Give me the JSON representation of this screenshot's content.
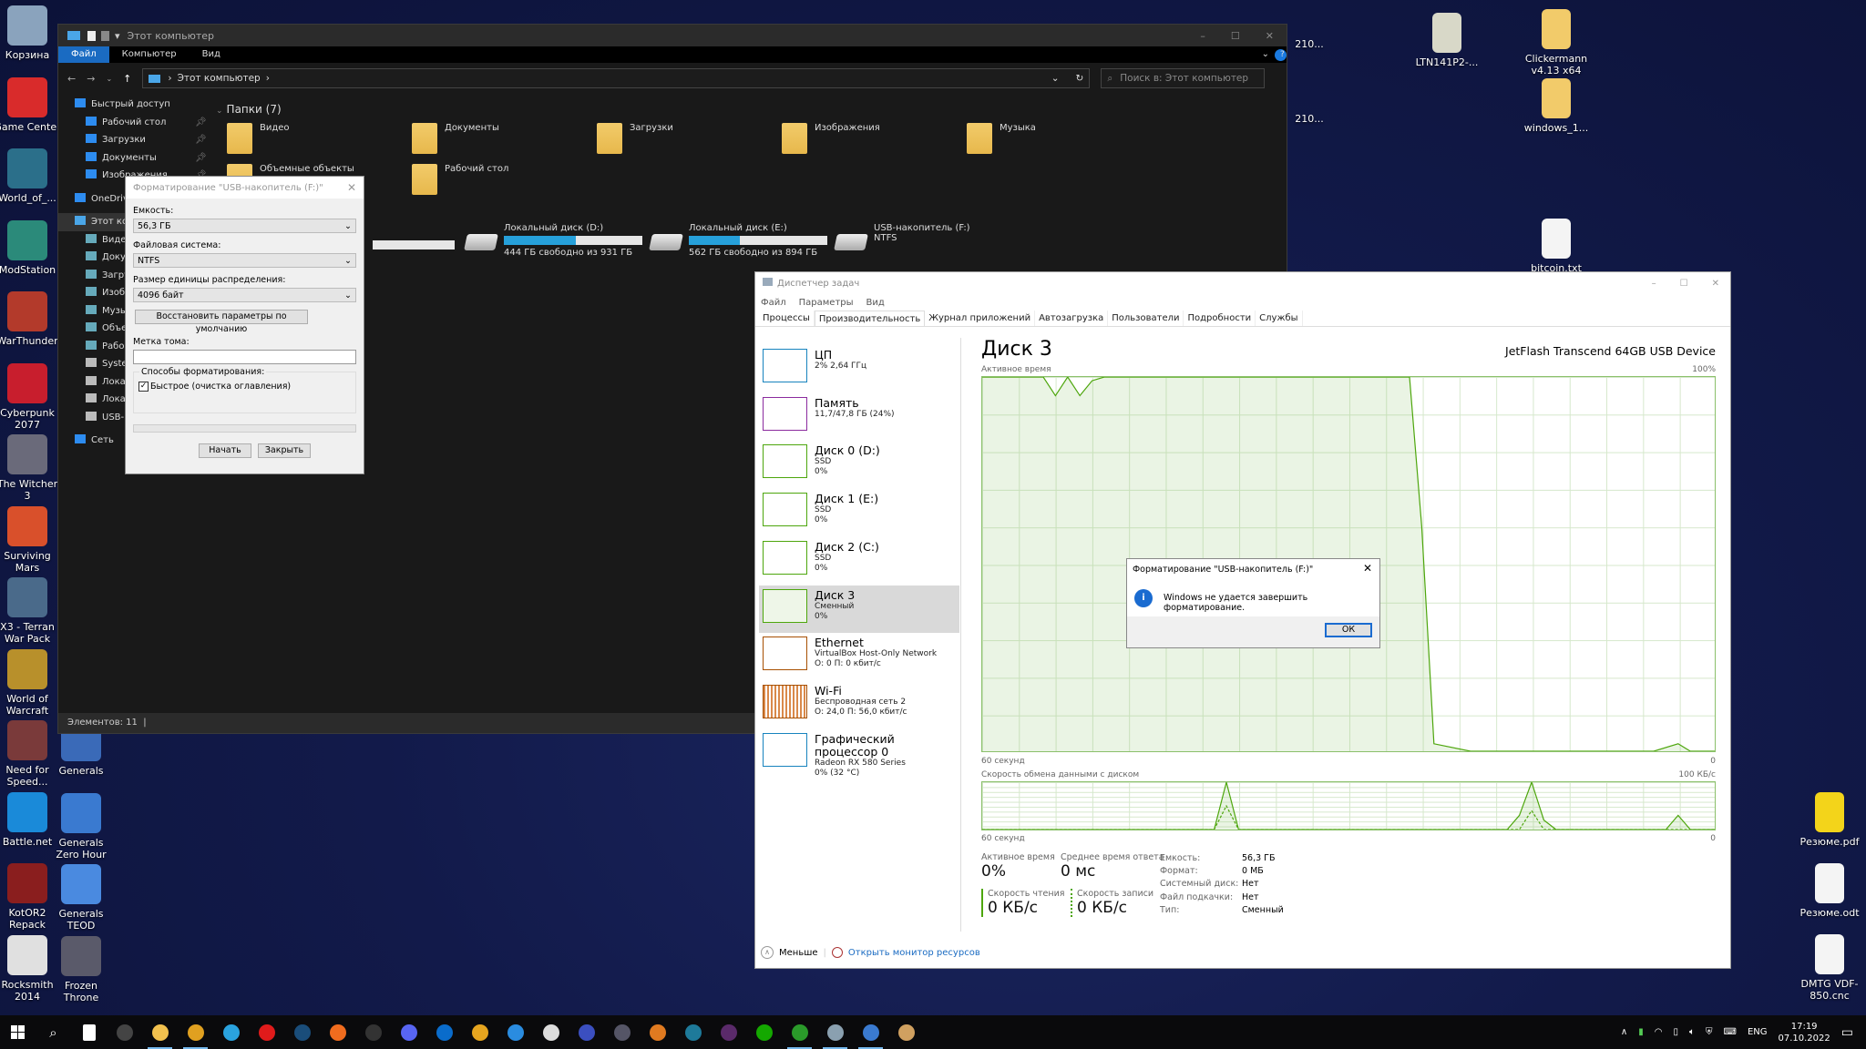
{
  "desktop": {
    "left_icons": [
      {
        "label": "Корзина",
        "color": "#8aa3bd"
      },
      {
        "label": "Game Center",
        "color": "#d92b2b"
      },
      {
        "label": "World_of_...",
        "color": "#2b6f8a"
      },
      {
        "label": "ModStation",
        "color": "#2b8a7a"
      },
      {
        "label": "WarThunder",
        "color": "#b33a2b"
      },
      {
        "label": "Cyberpunk 2077",
        "color": "#c81e2d"
      },
      {
        "label": "The Witcher 3",
        "color": "#6a6a7a"
      },
      {
        "label": "Surviving Mars",
        "color": "#d9502b"
      },
      {
        "label": "X3 - Terran War Pack",
        "color": "#4a6a8a"
      },
      {
        "label": "World of Warcraft",
        "color": "#b8902b"
      },
      {
        "label": "Need for Speed...",
        "color": "#7a3a3a"
      },
      {
        "label": "Battle.net",
        "color": "#1a8ad9"
      },
      {
        "label": "KotOR2 Repack",
        "color": "#8a1e1e"
      },
      {
        "label": "Rocksmith 2014",
        "color": "#e0e0e0"
      }
    ],
    "second_column_icons": [
      {
        "label": "Generals",
        "color": "#3a6ab8"
      },
      {
        "label": "Generals Zero Hour",
        "color": "#3a7ad0"
      },
      {
        "label": "Generals TEOD",
        "color": "#4a8ae0"
      },
      {
        "label": "Frozen Throne",
        "color": "#5a5a6a"
      }
    ],
    "right_icons": [
      {
        "label": "LTN141P2-...",
        "color": "#d8d8c8"
      },
      {
        "label": "Clickermann v4.13 x64",
        "color": "#f2cb6a"
      },
      {
        "label": "windows_1...",
        "color": "#f2cb6a"
      },
      {
        "label": "bitcoin.txt",
        "color": "#f4f4f4"
      },
      {
        "label": "Резюме.pdf",
        "color": "#f3d41a"
      },
      {
        "label": "Резюме.odt",
        "color": "#f4f4f4"
      },
      {
        "label": "DMTG VDF-850.cnc",
        "color": "#f4f4f4"
      }
    ],
    "partial_labels": [
      "210...",
      "210..."
    ]
  },
  "explorer": {
    "title": "Этот компьютер",
    "ribbon_tabs": [
      "Файл",
      "Компьютер",
      "Вид"
    ],
    "address": "Этот компьютер",
    "search_placeholder": "Поиск в: Этот компьютер",
    "nav": {
      "quick_access": "Быстрый доступ",
      "quick_items": [
        "Рабочий стол",
        "Загрузки",
        "Документы",
        "Изображения"
      ],
      "onedrive": "OneDrive",
      "this_pc": "Этот компьютер",
      "pc_items": [
        "Видео",
        "Документы",
        "Загрузки",
        "Изображения",
        "Музыка",
        "Объемные объекты",
        "Рабочий стол",
        "System",
        "Локальный диск",
        "Локальный диск",
        "USB-накопитель"
      ],
      "network": "Сеть"
    },
    "folders_header": "Папки (7)",
    "folders": [
      "Видео",
      "Документы",
      "Загрузки",
      "Изображения",
      "Музыка",
      "Объемные объекты",
      "Рабочий стол"
    ],
    "drives": [
      {
        "name": "Локальный диск (D:)",
        "info": "444 ГБ свободно из 931 ГБ",
        "used_fraction": 0.52
      },
      {
        "name": "Локальный диск (E:)",
        "info": "562 ГБ свободно из 894 ГБ",
        "used_fraction": 0.37
      },
      {
        "name": "USB-накопитель (F:)",
        "info": "NTFS"
      }
    ],
    "status": "Элементов: 11"
  },
  "format_dialog": {
    "title": "Форматирование \"USB-накопитель (F:)\"",
    "capacity_label": "Емкость:",
    "capacity_value": "56,3 ГБ",
    "fs_label": "Файловая система:",
    "fs_value": "NTFS",
    "alloc_label": "Размер единицы распределения:",
    "alloc_value": "4096 байт",
    "restore_button": "Восстановить параметры по умолчанию",
    "volume_label": "Метка тома:",
    "volume_value": "",
    "methods_label": "Способы форматирования:",
    "quick_label": "Быстрое (очистка оглавления)",
    "quick_checked": true,
    "start_button": "Начать",
    "close_button": "Закрыть"
  },
  "task_manager": {
    "title": "Диспетчер задач",
    "menu": [
      "Файл",
      "Параметры",
      "Вид"
    ],
    "tabs": [
      "Процессы",
      "Производительность",
      "Журнал приложений",
      "Автозагрузка",
      "Пользователи",
      "Подробности",
      "Службы"
    ],
    "active_tab": "Производительность",
    "sidebar": [
      {
        "title": "ЦП",
        "line1": "2% 2,64 ГГц",
        "line2": "",
        "color": "#1783be"
      },
      {
        "title": "Память",
        "line1": "11,7/47,8 ГБ (24%)",
        "line2": "",
        "color": "#8b2b9e"
      },
      {
        "title": "Диск 0 (D:)",
        "line1": "SSD",
        "line2": "0%",
        "color": "#4da60c"
      },
      {
        "title": "Диск 1 (E:)",
        "line1": "SSD",
        "line2": "0%",
        "color": "#4da60c"
      },
      {
        "title": "Диск 2 (C:)",
        "line1": "SSD",
        "line2": "0%",
        "color": "#4da60c"
      },
      {
        "title": "Диск 3",
        "line1": "Сменный",
        "line2": "0%",
        "color": "#4da60c"
      },
      {
        "title": "Ethernet",
        "line1": "VirtualBox Host-Only Network",
        "line2": "О: 0 П: 0 кбит/с",
        "color": "#a74f01"
      },
      {
        "title": "Wi-Fi",
        "line1": "Беспроводная сеть 2",
        "line2": "О: 24,0 П: 56,0 кбит/с",
        "color": "#a74f01"
      },
      {
        "title": "Графический процессор 0",
        "line1": "Radeon RX 580 Series",
        "line2": "0% (32 °C)",
        "color": "#1783be"
      }
    ],
    "selected_index": 5,
    "main": {
      "heading": "Диск 3",
      "device": "JetFlash Transcend 64GB USB Device",
      "active_label": "Активное время",
      "active_max": "100%",
      "time_label": "60 секунд",
      "zero": "0",
      "transfer_label": "Скорость обмена данными с диском",
      "transfer_max": "100 КБ/с",
      "stats": {
        "active_time_label": "Активное время",
        "active_time": "0%",
        "resp_label": "Среднее время ответа",
        "resp": "0 мс",
        "read_label": "Скорость чтения",
        "read": "0 КБ/с",
        "write_label": "Скорость записи",
        "write": "0 КБ/с"
      },
      "info": [
        {
          "k": "Емкость:",
          "v": "56,3 ГБ"
        },
        {
          "k": "Формат:",
          "v": "0 МБ"
        },
        {
          "k": "Системный диск:",
          "v": "Нет"
        },
        {
          "k": "Файл подкачки:",
          "v": "Нет"
        },
        {
          "k": "Тип:",
          "v": "Сменный"
        }
      ]
    },
    "footer_less": "Меньше",
    "footer_link": "Открыть монитор ресурсов"
  },
  "chart_data": [
    {
      "type": "area",
      "title": "Активное время",
      "xlabel": "60 секунд",
      "ylabel": "",
      "ylim": [
        0,
        100
      ],
      "x_seconds_ago": [
        60,
        57,
        56,
        55,
        54,
        53,
        52,
        51,
        50,
        49,
        45,
        40,
        30,
        25,
        24,
        23,
        20,
        10,
        5,
        3,
        2,
        0
      ],
      "values": [
        100,
        100,
        100,
        100,
        95,
        100,
        95,
        99,
        100,
        100,
        100,
        100,
        100,
        100,
        60,
        2,
        0,
        0,
        0,
        2,
        0,
        0
      ]
    },
    {
      "type": "line",
      "title": "Скорость обмена данными с диском",
      "xlabel": "60 секунд",
      "ylabel": "КБ/с",
      "ylim": [
        0,
        100
      ],
      "x_seconds_ago": [
        60,
        42,
        41,
        40,
        39,
        38,
        37,
        36,
        35,
        34,
        17,
        16,
        15,
        14,
        13,
        12,
        4,
        3,
        2,
        0
      ],
      "series": [
        {
          "name": "Скорость чтения",
          "values": [
            0,
            0,
            0,
            100,
            0,
            0,
            0,
            0,
            0,
            0,
            0,
            30,
            100,
            20,
            0,
            0,
            0,
            30,
            0,
            0
          ]
        },
        {
          "name": "Скорость записи",
          "values": [
            0,
            0,
            0,
            50,
            0,
            0,
            0,
            0,
            0,
            0,
            0,
            0,
            40,
            0,
            0,
            0,
            0,
            0,
            0,
            0
          ]
        }
      ]
    }
  ],
  "error_dialog": {
    "title": "Форматирование \"USB-накопитель (F:)\"",
    "message": "Windows не удается завершить форматирование.",
    "ok_button": "ОК"
  },
  "taskbar": {
    "apps": [
      {
        "name": "task-view",
        "color": "#ffffff"
      },
      {
        "name": "terminal",
        "color": "#444444"
      },
      {
        "name": "file-explorer",
        "color": "#f2c14e"
      },
      {
        "name": "chrome",
        "color": "#e0a020"
      },
      {
        "name": "telegram",
        "color": "#2aa3df"
      },
      {
        "name": "youtube-music",
        "color": "#e01b1b"
      },
      {
        "name": "steam",
        "color": "#1a4d7a"
      },
      {
        "name": "origin",
        "color": "#f06c1e"
      },
      {
        "name": "epic-games",
        "color": "#333333"
      },
      {
        "name": "discord",
        "color": "#5865f2"
      },
      {
        "name": "outlook",
        "color": "#0a6ccb"
      },
      {
        "name": "layers-app",
        "color": "#e6a51f"
      },
      {
        "name": "vscode",
        "color": "#2a8ce0"
      },
      {
        "name": "unity",
        "color": "#dddddd"
      },
      {
        "name": "app-flame",
        "color": "#3b4fc0"
      },
      {
        "name": "ableton-live",
        "color": "#555566"
      },
      {
        "name": "gog-galaxy",
        "color": "#e07a20"
      },
      {
        "name": "panel-app",
        "color": "#1e7a9a"
      },
      {
        "name": "app-purple",
        "color": "#5a2a6a"
      },
      {
        "name": "upwork",
        "color": "#14a800"
      },
      {
        "name": "xbox",
        "color": "#2a9a2a"
      },
      {
        "name": "resource-monitor",
        "color": "#8aa0b0"
      },
      {
        "name": "qbittorrent",
        "color": "#3a7ad0"
      },
      {
        "name": "paint",
        "color": "#d0a060"
      }
    ],
    "tray": {
      "lang": "ENG",
      "time": "17:19",
      "date": "07.10.2022"
    }
  }
}
